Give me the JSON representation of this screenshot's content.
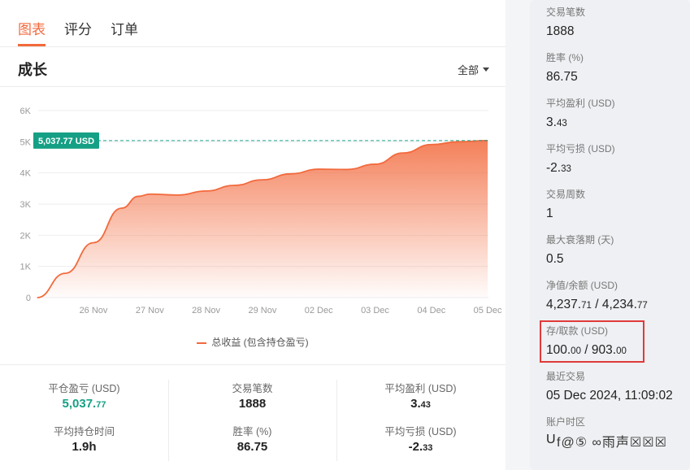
{
  "tabs": [
    {
      "label": "图表",
      "active": true
    },
    {
      "label": "评分",
      "active": false
    },
    {
      "label": "订单",
      "active": false
    }
  ],
  "section": {
    "title": "成长",
    "filter_label": "全部"
  },
  "chart_data": {
    "type": "area",
    "x_labels": [
      "26 Nov",
      "27 Nov",
      "28 Nov",
      "29 Nov",
      "02 Dec",
      "03 Dec",
      "04 Dec",
      "05 Dec"
    ],
    "y_ticks": [
      "0",
      "1K",
      "2K",
      "3K",
      "4K",
      "5K",
      "6K"
    ],
    "ylim": [
      0,
      6000
    ],
    "series": [
      {
        "name": "总收益 (包含持仓盈亏)",
        "color": "#f26a3d",
        "points": [
          [
            -1.0,
            0
          ],
          [
            -0.5,
            780
          ],
          [
            0.0,
            1760
          ],
          [
            0.5,
            2870
          ],
          [
            0.8,
            3250
          ],
          [
            1.0,
            3320
          ],
          [
            1.5,
            3290
          ],
          [
            2.0,
            3420
          ],
          [
            2.5,
            3600
          ],
          [
            3.0,
            3780
          ],
          [
            3.5,
            3970
          ],
          [
            4.0,
            4120
          ],
          [
            4.5,
            4110
          ],
          [
            5.0,
            4280
          ],
          [
            5.5,
            4640
          ],
          [
            6.0,
            4910
          ],
          [
            6.5,
            5000
          ],
          [
            7.0,
            5037.77
          ]
        ]
      }
    ],
    "reference_line": {
      "value": 5037.77,
      "label": "5,037.77 USD"
    },
    "grid": true
  },
  "legend": {
    "label": "总收益 (包含持仓盈亏)"
  },
  "stats": [
    [
      {
        "label": "平仓盈亏 (USD)",
        "int": "5,037.",
        "dec": "77",
        "green": true
      },
      {
        "label": "平均持仓时间",
        "int": "1.9h",
        "dec": "",
        "green": false
      }
    ],
    [
      {
        "label": "交易笔数",
        "int": "1888",
        "dec": "",
        "green": false
      },
      {
        "label": "胜率 (%)",
        "int": "86.75",
        "dec": "",
        "green": false
      }
    ],
    [
      {
        "label": "平均盈利 (USD)",
        "int": "3.",
        "dec": "43",
        "green": false
      },
      {
        "label": "平均亏损 (USD)",
        "int": "-2.",
        "dec": "33",
        "green": false
      }
    ]
  ],
  "side": {
    "items": [
      {
        "label": "交易笔数",
        "v1": "1888",
        "d1": "",
        "sep": "",
        "v2": "",
        "d2": ""
      },
      {
        "label": "胜率 (%)",
        "v1": "86.75",
        "d1": "",
        "sep": "",
        "v2": "",
        "d2": ""
      },
      {
        "label": "平均盈利 (USD)",
        "v1": "3.",
        "d1": "43",
        "sep": "",
        "v2": "",
        "d2": ""
      },
      {
        "label": "平均亏损 (USD)",
        "v1": "-2.",
        "d1": "33",
        "sep": "",
        "v2": "",
        "d2": ""
      },
      {
        "label": "交易周数",
        "v1": "1",
        "d1": "",
        "sep": "",
        "v2": "",
        "d2": ""
      },
      {
        "label": "最大衰落期 (天)",
        "v1": "0.5",
        "d1": "",
        "sep": "",
        "v2": "",
        "d2": ""
      },
      {
        "label": "净值/余额 (USD)",
        "v1": "4,237.",
        "d1": "71",
        "sep": " / ",
        "v2": "4,234.",
        "d2": "77"
      },
      {
        "label": "存/取款 (USD)",
        "v1": "100.",
        "d1": "00",
        "sep": " / ",
        "v2": "903.",
        "d2": "00"
      },
      {
        "label": "最近交易",
        "v1": "05 Dec 2024, 11:09:02",
        "d1": "",
        "sep": "",
        "v2": "",
        "d2": ""
      },
      {
        "label": "账户时区",
        "v1": "",
        "d1": "",
        "sep": "",
        "v2": "",
        "d2": ""
      }
    ],
    "highlight_color": "#e03a3a"
  },
  "watermark": {
    "prefix": "U",
    "text": "f@⑤ ∞雨声☒☒☒"
  }
}
